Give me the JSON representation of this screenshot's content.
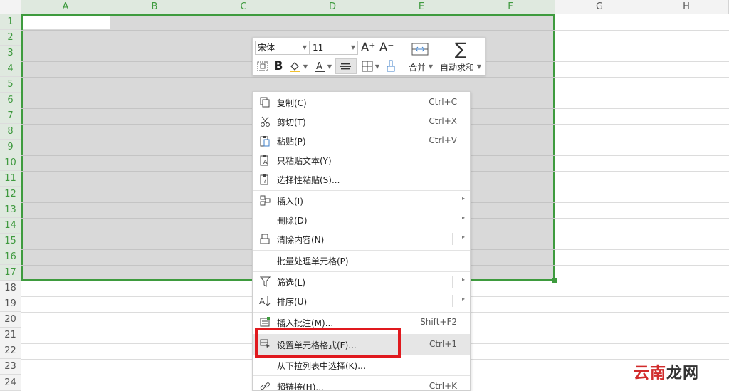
{
  "columns": [
    "A",
    "B",
    "C",
    "D",
    "E",
    "F",
    "G",
    "H"
  ],
  "rows": [
    "1",
    "2",
    "3",
    "4",
    "5",
    "6",
    "7",
    "8",
    "9",
    "10",
    "11",
    "12",
    "13",
    "14",
    "15",
    "16",
    "17",
    "18",
    "19",
    "20",
    "21",
    "22",
    "23",
    "24"
  ],
  "toolbar": {
    "font_name": "宋体",
    "font_size": "11",
    "increase_font": "A⁺",
    "decrease_font": "A⁻",
    "merge_label": "合并",
    "autosum_label": "自动求和",
    "bold": "B"
  },
  "menu": {
    "copy": {
      "label": "复制(C)",
      "shortcut": "Ctrl+C"
    },
    "cut": {
      "label": "剪切(T)",
      "shortcut": "Ctrl+X"
    },
    "paste": {
      "label": "粘贴(P)",
      "shortcut": "Ctrl+V"
    },
    "paste_text": {
      "label": "只粘贴文本(Y)"
    },
    "paste_special": {
      "label": "选择性粘贴(S)..."
    },
    "insert": {
      "label": "插入(I)"
    },
    "delete": {
      "label": "删除(D)"
    },
    "clear": {
      "label": "清除内容(N)"
    },
    "batch": {
      "label": "批量处理单元格(P)"
    },
    "filter": {
      "label": "筛选(L)"
    },
    "sort": {
      "label": "排序(U)"
    },
    "comment": {
      "label": "插入批注(M)...",
      "shortcut": "Shift+F2"
    },
    "format_cells": {
      "label": "设置单元格格式(F)...",
      "shortcut": "Ctrl+1"
    },
    "pick_list": {
      "label": "从下拉列表中选择(K)..."
    },
    "hyperlink": {
      "label": "超链接(H)...",
      "shortcut": "Ctrl+K"
    }
  },
  "watermark": {
    "part1": "云南",
    "part2": "龙网"
  },
  "colors": {
    "selection_border": "#3e9b3e",
    "highlight_box": "#e0191e"
  }
}
